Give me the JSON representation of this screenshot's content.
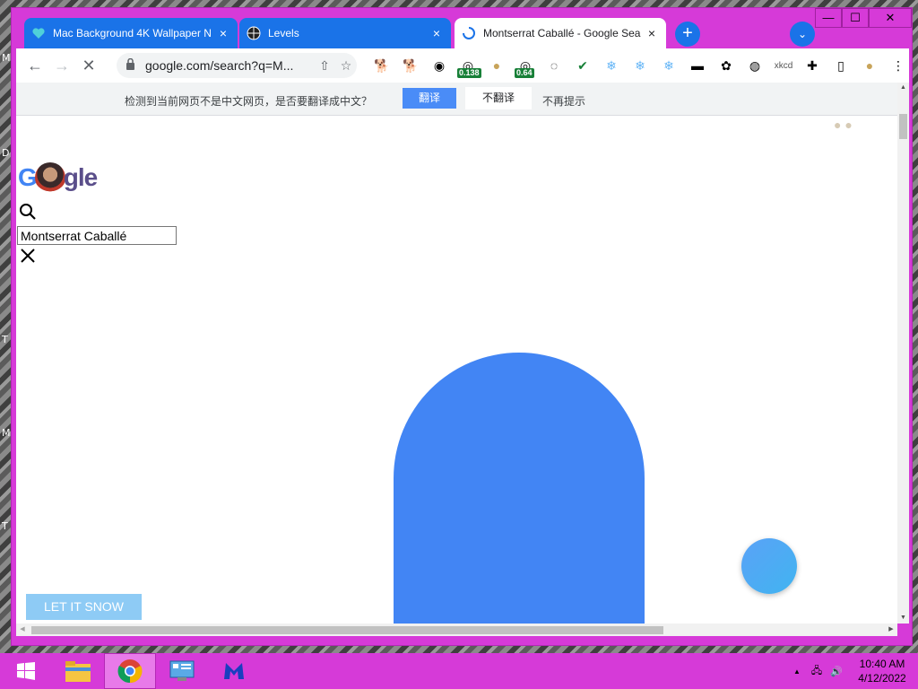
{
  "desktop": {
    "edge_letters": [
      "M",
      "D",
      "T",
      "M",
      "T"
    ]
  },
  "window": {
    "tabs": [
      {
        "title": "Mac Background 4K Wallpaper N",
        "close": "×",
        "favicon": "heart-icon",
        "active": false
      },
      {
        "title": "Levels",
        "close": "×",
        "favicon": "globe-icon",
        "active": false
      },
      {
        "title": "Montserrat Caballé - Google Sea",
        "close": "×",
        "favicon": "loading-spinner-icon",
        "active": true
      }
    ],
    "new_tab_label": "+",
    "tab_search_label": "⌄",
    "controls": {
      "minimize": "—",
      "maximize": "☐",
      "close": "✕"
    }
  },
  "toolbar": {
    "back": "←",
    "forward": "→",
    "stop": "✕",
    "url": "google.com/search?q=M...",
    "share": "⇧",
    "bookmark": "☆",
    "extensions": [
      {
        "name": "doge-extension-icon",
        "glyph": "🐕",
        "badge": ""
      },
      {
        "name": "doge-extension-icon-2",
        "glyph": "🐕",
        "badge": ""
      },
      {
        "name": "face-extension-icon",
        "glyph": "◉",
        "badge": ""
      },
      {
        "name": "gauge-extension-icon",
        "glyph": "◎",
        "badge": "0.138"
      },
      {
        "name": "doge-coin-extension-icon",
        "glyph": "●",
        "badge": ""
      },
      {
        "name": "gauge-extension-icon-2",
        "glyph": "◎",
        "badge": "0.64"
      },
      {
        "name": "disk-extension-icon",
        "glyph": "◌",
        "badge": ""
      },
      {
        "name": "check-extension-icon",
        "glyph": "✔",
        "badge": ""
      },
      {
        "name": "snowflake-extension-icon",
        "glyph": "❄",
        "badge": ""
      },
      {
        "name": "snowflake-extension-icon-2",
        "glyph": "❄",
        "badge": ""
      },
      {
        "name": "snowflake-extension-icon-3",
        "glyph": "❄",
        "badge": ""
      },
      {
        "name": "color-bar-extension-icon",
        "glyph": "▬",
        "badge": ""
      },
      {
        "name": "mask-extension-icon",
        "glyph": "✿",
        "badge": ""
      },
      {
        "name": "target-extension-icon",
        "glyph": "◍",
        "badge": ""
      },
      {
        "name": "xkcd-extension-icon",
        "glyph": "xkcd",
        "badge": ""
      },
      {
        "name": "puzzle-extension-icon",
        "glyph": "✚",
        "badge": ""
      },
      {
        "name": "sidepanel-icon",
        "glyph": "▯",
        "badge": ""
      },
      {
        "name": "profile-icon",
        "glyph": "●",
        "badge": ""
      },
      {
        "name": "menu-icon",
        "glyph": "⋮",
        "badge": ""
      }
    ]
  },
  "translate_bar": {
    "prompt": "检测到当前网页不是中文网页，是否要翻译成中文？",
    "translate": "翻译",
    "dont_translate": "不翻译",
    "never": "不再提示"
  },
  "page": {
    "logo_left": "G",
    "logo_right": "gle",
    "search_value": "Montserrat Caballé",
    "let_it_snow": "LET IT SNOW",
    "accent_color": "#4285f4"
  },
  "taskbar": {
    "apps": [
      "start-icon",
      "file-explorer-icon",
      "chrome-icon",
      "control-panel-icon",
      "malwarebytes-icon"
    ],
    "tray": {
      "up_arrow": "▲",
      "network": "🖧",
      "volume": "🔊"
    },
    "time": "10:40 AM",
    "date": "4/12/2022"
  }
}
